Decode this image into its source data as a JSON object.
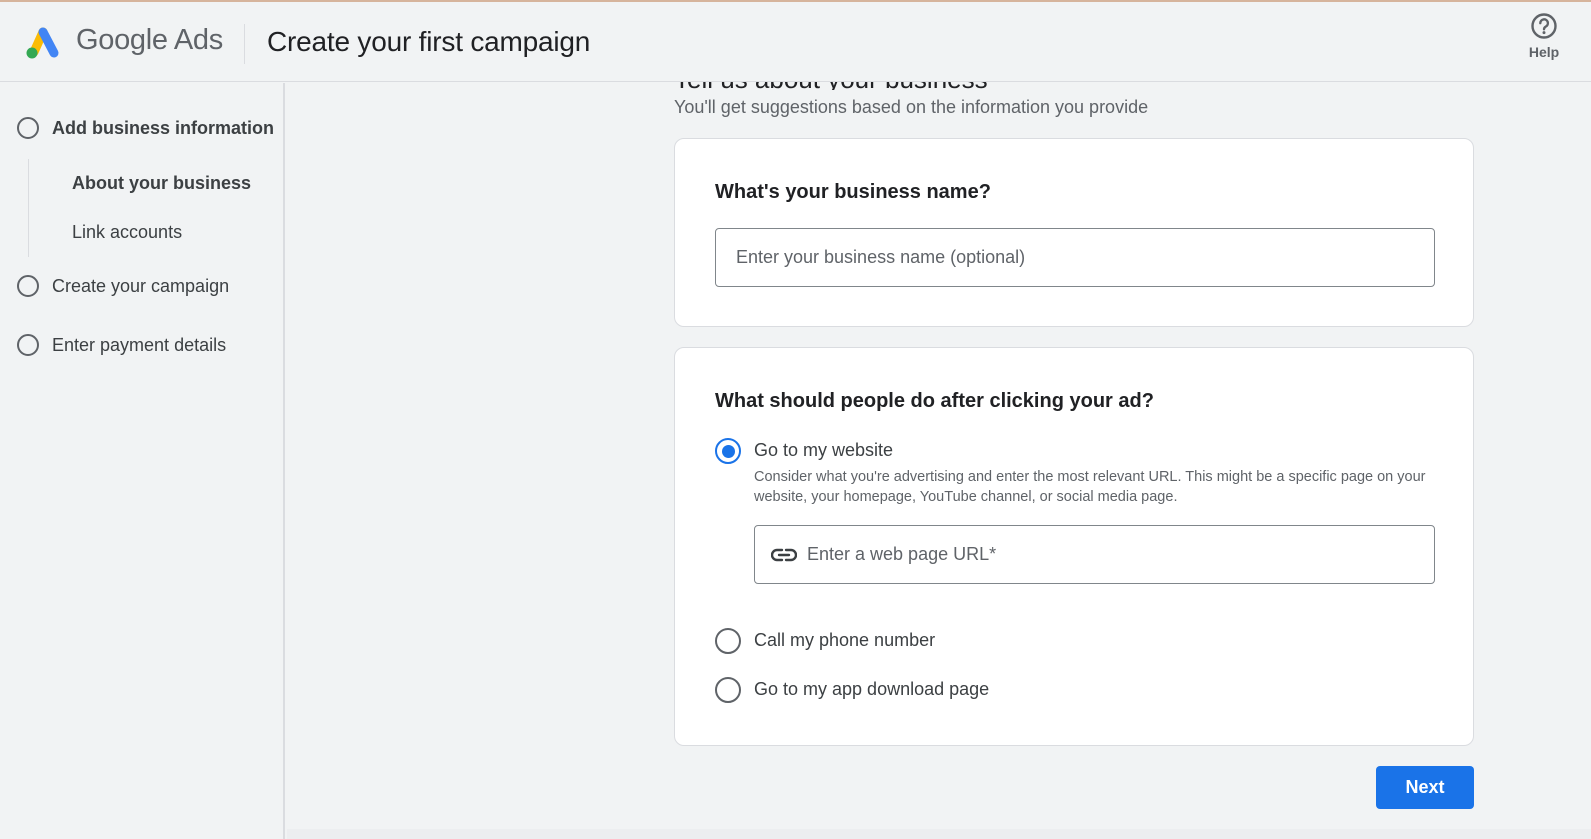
{
  "header": {
    "brand": "Google Ads",
    "title": "Create your first campaign",
    "help_label": "Help",
    "logo_colors": {
      "blue": "#4285f4",
      "yellow": "#fbbc04",
      "green": "#34a853"
    }
  },
  "sidebar": {
    "steps": [
      {
        "label": "Add business information",
        "icon": "radio-ring-icon",
        "active": true
      },
      {
        "label": "Create your campaign",
        "icon": "radio-ring-icon",
        "active": false
      },
      {
        "label": "Enter payment details",
        "icon": "radio-ring-icon",
        "active": false
      }
    ],
    "substeps": [
      {
        "label": "About your business",
        "active": true
      },
      {
        "label": "Link accounts",
        "active": false
      }
    ]
  },
  "main": {
    "heading": "Tell us about your business",
    "subheading": "You'll get suggestions based on the information you provide",
    "business_name": {
      "question": "What's your business name?",
      "value": "",
      "placeholder": "Enter your business name (optional)"
    },
    "after_click": {
      "question": "What should people do after clicking your ad?",
      "options": [
        {
          "label": "Go to my website",
          "checked": true
        },
        {
          "label": "Call my phone number",
          "checked": false
        },
        {
          "label": "Go to my app download page",
          "checked": false
        }
      ],
      "website_description": "Consider what you're advertising and enter the most relevant URL. This might be a specific page on your website, your homepage, YouTube channel, or social media page.",
      "url_field": {
        "value": "",
        "placeholder": "Enter a web page URL*",
        "icon": "link-icon"
      }
    },
    "next_label": "Next"
  },
  "colors": {
    "accent": "#1a73e8",
    "background": "#f1f3f4",
    "card": "#ffffff"
  }
}
